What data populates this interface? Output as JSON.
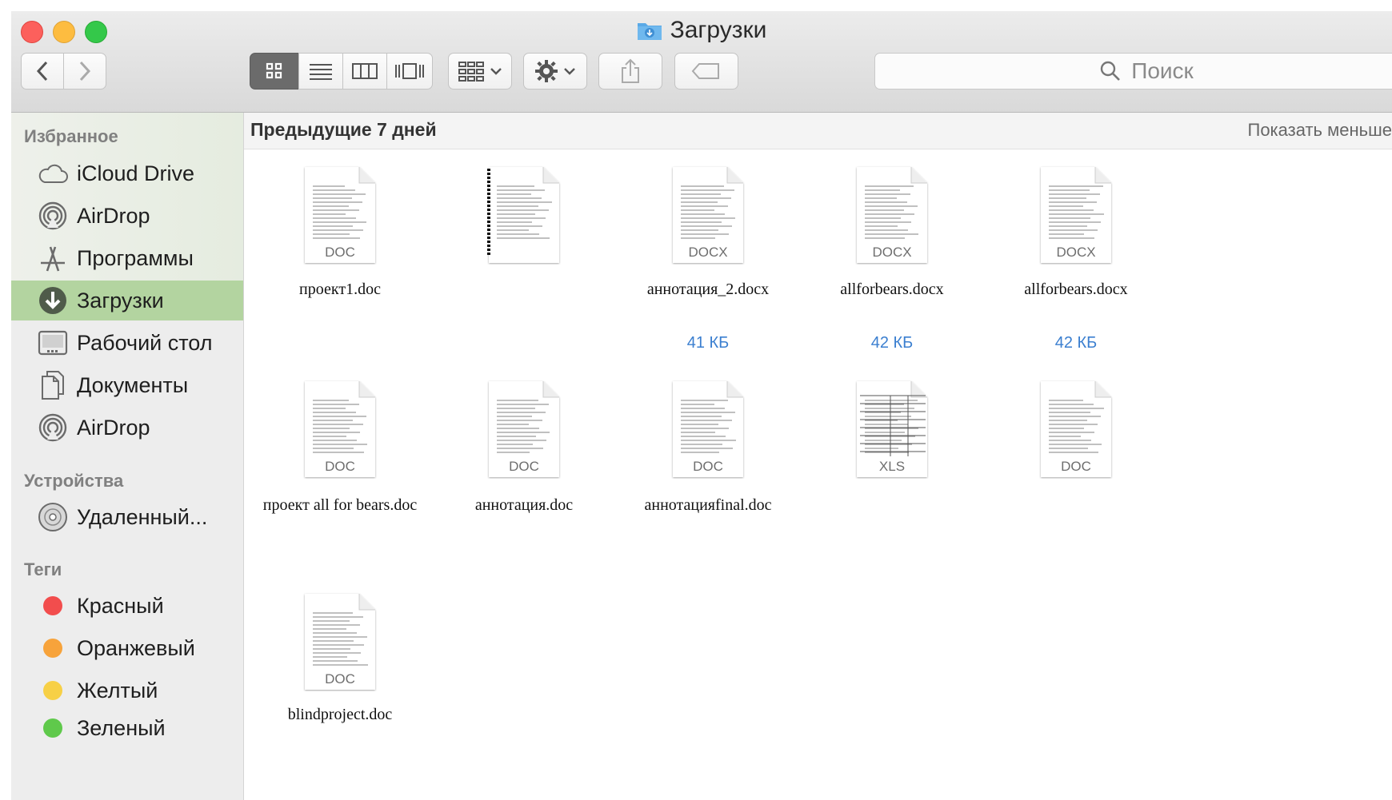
{
  "window": {
    "title": "Загрузки"
  },
  "toolbar": {
    "search_placeholder": "Поиск"
  },
  "sidebar": {
    "favorites_header": "Избранное",
    "favorites": [
      {
        "label": "iCloud Drive",
        "icon": "cloud-icon"
      },
      {
        "label": "AirDrop",
        "icon": "airdrop-icon"
      },
      {
        "label": "Программы",
        "icon": "applications-icon"
      },
      {
        "label": "Загрузки",
        "icon": "downloads-icon",
        "selected": true
      },
      {
        "label": "Рабочий стол",
        "icon": "desktop-icon"
      },
      {
        "label": "Документы",
        "icon": "documents-icon"
      },
      {
        "label": "AirDrop",
        "icon": "airdrop-icon"
      }
    ],
    "devices_header": "Устройства",
    "devices": [
      {
        "label": "Удаленный...",
        "icon": "remote-disc-icon"
      }
    ],
    "tags_header": "Теги",
    "tags": [
      {
        "label": "Красный",
        "color": "#f24d4d"
      },
      {
        "label": "Оранжевый",
        "color": "#f7a33b"
      },
      {
        "label": "Желтый",
        "color": "#f7d046"
      },
      {
        "label": "Зеленый",
        "color": "#5fc94b"
      }
    ]
  },
  "main": {
    "group_title": "Предыдущие 7 дней",
    "show_less": "Показать меньше",
    "files": [
      {
        "name": "проект1.doc",
        "ext": "DOC",
        "size": ""
      },
      {
        "name": "",
        "ext": "",
        "size": ""
      },
      {
        "name": "аннотация_2.docx",
        "ext": "DOCX",
        "size": "41 КБ"
      },
      {
        "name": "allforbears.docx",
        "ext": "DOCX",
        "size": "42 КБ"
      },
      {
        "name": "allforbears.docx",
        "ext": "DOCX",
        "size": "42 КБ"
      },
      {
        "name": "проект all for bears.doc",
        "ext": "DOC",
        "size": ""
      },
      {
        "name": "аннотация.doc",
        "ext": "DOC",
        "size": ""
      },
      {
        "name": "аннотацияfinal.doc",
        "ext": "DOC",
        "size": ""
      },
      {
        "name": "",
        "ext": "XLS",
        "size": ""
      },
      {
        "name": "",
        "ext": "DOC",
        "size": ""
      },
      {
        "name": "blindproject.doc",
        "ext": "DOC",
        "size": ""
      }
    ]
  },
  "colors": {
    "selection": "#b3d4a0",
    "size_text": "#3b7fd0"
  }
}
